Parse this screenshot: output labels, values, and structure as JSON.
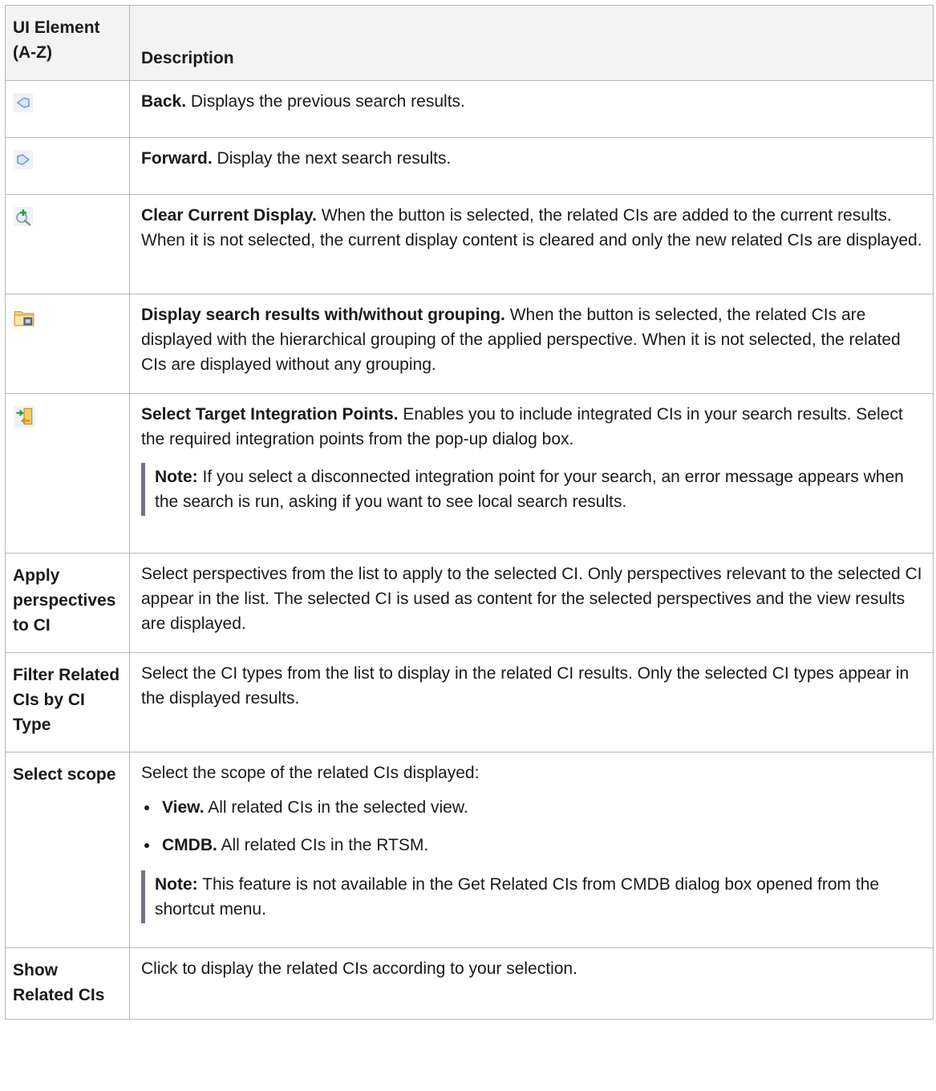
{
  "table": {
    "header": {
      "col1": "UI Element (A-Z)",
      "col2": "Description"
    },
    "rows": [
      {
        "icon": "back-arrow-icon",
        "title": "Back.",
        "text": " Displays the previous search results."
      },
      {
        "icon": "forward-arrow-icon",
        "title": "Forward.",
        "text": " Display the next search results."
      },
      {
        "icon": "magnifier-plus-icon",
        "title": "Clear Current Display.",
        "text": " When the button is selected, the related CIs are added to the current results. When it is not selected, the current display content is cleared and only the new related CIs are displayed."
      },
      {
        "icon": "folder-grouping-icon",
        "title": "Display search results with/without grouping.",
        "text": " When the button is selected, the related CIs are displayed with the hierarchical grouping of the applied perspective. When it is not selected, the related CIs are displayed without any grouping."
      },
      {
        "icon": "integration-points-icon",
        "title": "Select Target Integration Points.",
        "text": " Enables you to include integrated CIs in your search results. Select the required integration points from the pop-up dialog box.",
        "note_label": "Note:",
        "note_text": " If you select a disconnected integration point for your search, an error message appears when the search is run, asking if you want to see local search results."
      },
      {
        "element": "Apply perspectives to CI",
        "text": "Select perspectives from the list to apply to the selected CI. Only perspectives relevant to the selected CI appear in the list. The selected CI is used as content for the selected perspectives and the view results are displayed."
      },
      {
        "element": "Filter Related CIs by CI Type",
        "text": "Select the CI types from the list to display in the related CI results. Only the selected CI types appear in the displayed results."
      },
      {
        "element": "Select scope",
        "text": "Select the scope of the related CIs displayed:",
        "bullets": [
          {
            "label": "View.",
            "text": " All related CIs in the selected view."
          },
          {
            "label": "CMDB.",
            "text": " All related CIs in the RTSM."
          }
        ],
        "note_label": "Note:",
        "note_text": " This feature is not available in the Get Related CIs from CMDB dialog box opened from the shortcut menu."
      },
      {
        "element": "Show Related CIs",
        "text": "Click to display the related CIs according to your selection."
      }
    ]
  },
  "colors": {
    "header_bg": "#f3f3f3",
    "border": "#b8b8b8",
    "note_bar": "#7b6f82",
    "icon_blue": "#7aa6d8"
  }
}
